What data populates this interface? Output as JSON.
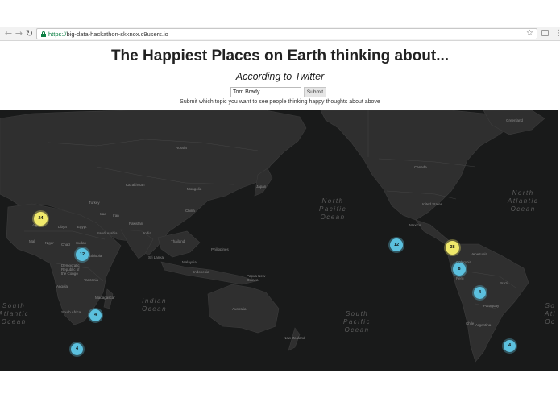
{
  "browser": {
    "url_scheme": "https://",
    "url_host": "big-data-hackathon-skknox.c9users.io",
    "back_icon": "arrow-left-icon",
    "forward_icon": "arrow-right-icon",
    "reload_icon": "reload-icon",
    "star_icon": "star-icon",
    "menu_icon": "more-vert-icon"
  },
  "header": {
    "title": "The Happiest Places on Earth thinking about...",
    "subtitle": "According to Twitter"
  },
  "form": {
    "topic_value": "Tom Brady",
    "submit_label": "Submit",
    "helper_text": "Submit which topic you want to see people thinking happy thoughts about above"
  },
  "map": {
    "oceans": {
      "north_pacific": "North\nPacific\nOcean",
      "north_atlantic": "North\nAtlantic\nOcean",
      "south_atlantic": "South\nAtlantic\nOcean",
      "indian": "Indian\nOcean",
      "south_pacific": "South\nPacific\nOcean",
      "south_atlantic_right": "So\nAtl\nOc"
    },
    "countries": {
      "russia": "Russia",
      "kazakhstan": "Kazakhstan",
      "mongolia": "Mongolia",
      "china": "China",
      "iran": "Iran",
      "pakistan": "Pakistan",
      "india": "India",
      "egypt": "Egypt",
      "libya": "Libya",
      "algeria": "Algeria",
      "sudan": "Sudan",
      "mali": "Mali",
      "niger": "Niger",
      "chad": "Chad",
      "ethiopia": "Ethiopia",
      "drc": "Democratic\nRepublic of\nthe Congo",
      "angola": "Angola",
      "tanzania": "Tanzania",
      "madagascar": "Madagascar",
      "south_africa": "South Africa",
      "sri_lanka": "Sri Lanka",
      "thailand": "Thailand",
      "philippines": "Philippines",
      "malaysia": "Malaysia",
      "indonesia": "Indonesia",
      "papua_new_guinea": "Papua New\nGuinea",
      "australia": "Australia",
      "new_zealand": "New Zealand",
      "japan": "Japan",
      "canada": "Canada",
      "united_states": "United States",
      "mexico": "Mexico",
      "colombia": "Colombia",
      "peru": "Peru",
      "brazil": "Brazil",
      "bolivia": "Bolivia",
      "paraguay": "Paraguay",
      "argentina": "Argentina",
      "chile": "Chile",
      "venezuela": "Venezuela",
      "greenland": "Greenland",
      "turkey": "Turkey",
      "iraq": "Iraq",
      "saudi_arabia": "Saudi Arabia"
    },
    "clusters": [
      {
        "count": "24",
        "kind": "big",
        "place": "Europe"
      },
      {
        "count": "12",
        "kind": "small",
        "place": "Mediterranean"
      },
      {
        "count": "4",
        "kind": "small",
        "place": "East Africa"
      },
      {
        "count": "4",
        "kind": "small",
        "place": "Southern Africa"
      },
      {
        "count": "12",
        "kind": "small",
        "place": "US West Coast"
      },
      {
        "count": "38",
        "kind": "big",
        "place": "US East"
      },
      {
        "count": "8",
        "kind": "small",
        "place": "Caribbean"
      },
      {
        "count": "4",
        "kind": "small",
        "place": "Venezuela"
      },
      {
        "count": "4",
        "kind": "small",
        "place": "Brazil"
      }
    ],
    "colors": {
      "water": "#191a1a",
      "land": "#2f2f2f",
      "cluster_small": "#5bc0de",
      "cluster_big": "#f0e96b"
    }
  }
}
